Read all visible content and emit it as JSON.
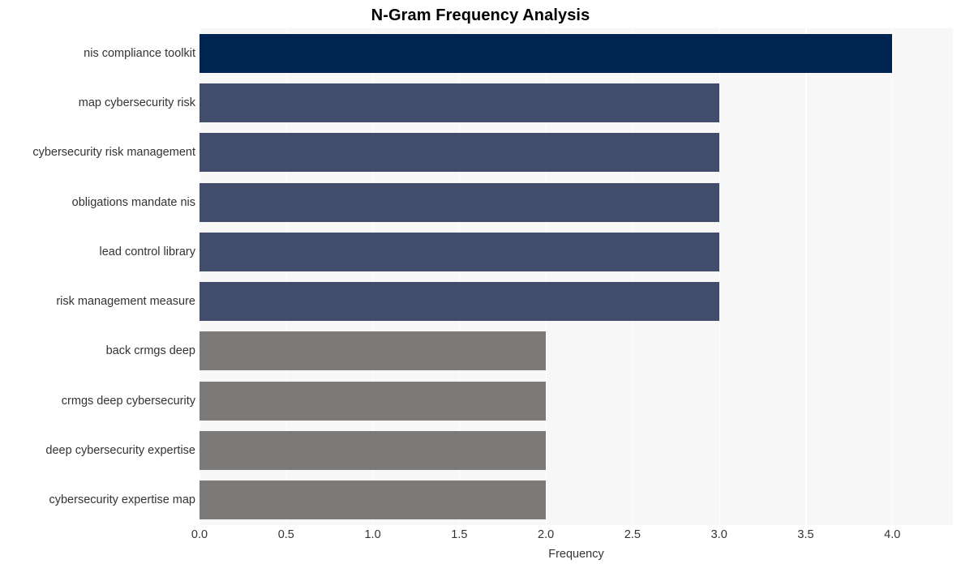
{
  "chart_data": {
    "type": "bar",
    "orientation": "horizontal",
    "title": "N-Gram Frequency Analysis",
    "xlabel": "Frequency",
    "ylabel": "",
    "xlim": [
      0,
      4.35
    ],
    "ylim": [
      0,
      10
    ],
    "grid": true,
    "legend": false,
    "categories": [
      "nis compliance toolkit",
      "map cybersecurity risk",
      "cybersecurity risk management",
      "obligations mandate nis",
      "lead control library",
      "risk management measure",
      "back crmgs deep",
      "crmgs deep cybersecurity",
      "deep cybersecurity expertise",
      "cybersecurity expertise map"
    ],
    "values": [
      4,
      3,
      3,
      3,
      3,
      3,
      2,
      2,
      2,
      2
    ],
    "bar_colors": [
      "#002450",
      "#424c6b",
      "#424c6b",
      "#424c6b",
      "#424c6b",
      "#424c6b",
      "#7b7a78",
      "#7b7a78",
      "#7b7a78",
      "#7b7a78"
    ],
    "xticks": [
      0.0,
      0.5,
      1.0,
      1.5,
      2.0,
      2.5,
      3.0,
      3.5,
      4.0
    ],
    "xtick_labels": [
      "0.0",
      "0.5",
      "1.0",
      "1.5",
      "2.0",
      "2.5",
      "3.0",
      "3.5",
      "4.0"
    ],
    "plot_background": "#f7f7f7",
    "figure_background": "#ffffff",
    "gridline_color": "#ffffff",
    "tick_label_color": "#333333",
    "title_color": "#000000"
  }
}
